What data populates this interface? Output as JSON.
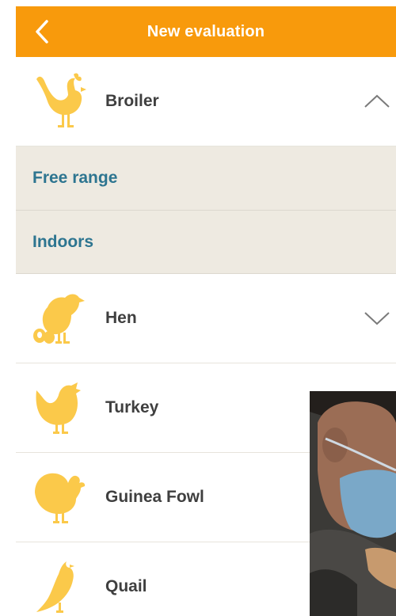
{
  "header": {
    "title": "New evaluation",
    "back_icon": "chevron-left-icon",
    "background": "#f89a0c"
  },
  "categories": [
    {
      "label": "Broiler",
      "icon": "rooster-icon",
      "expanded": true,
      "chevron": "chevron-up-icon"
    },
    {
      "label": "Hen",
      "icon": "hen-with-eggs-icon",
      "expanded": false,
      "chevron": "chevron-down-icon"
    },
    {
      "label": "Turkey",
      "icon": "chicken-icon"
    },
    {
      "label": "Guinea Fowl",
      "icon": "turkey-icon"
    },
    {
      "label": "Quail",
      "icon": "quail-icon"
    }
  ],
  "broiler_subitems": [
    {
      "label": "Free range"
    },
    {
      "label": "Indoors"
    }
  ],
  "colors": {
    "icon": "#fbc94a",
    "subitem_text": "#2d7590",
    "subitem_bg": "#eeeae1"
  }
}
